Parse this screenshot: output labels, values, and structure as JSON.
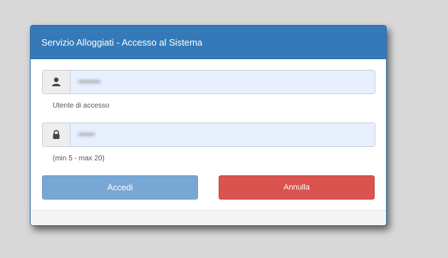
{
  "dialog": {
    "title": "Servizio Alloggiati - Accesso al Sistema"
  },
  "login": {
    "username_value": "••••••••",
    "username_icon": "user-icon",
    "username_help": "Utente di accesso",
    "password_value": "••••••",
    "password_icon": "lock-icon",
    "password_help": "(min 5 - max 20)"
  },
  "buttons": {
    "login_label": "Accedi",
    "cancel_label": "Annulla"
  },
  "colors": {
    "header": "#3579b8",
    "primary_button": "#79a7d4",
    "danger_button": "#d9534f",
    "input_autofill": "#e8f0fe"
  }
}
